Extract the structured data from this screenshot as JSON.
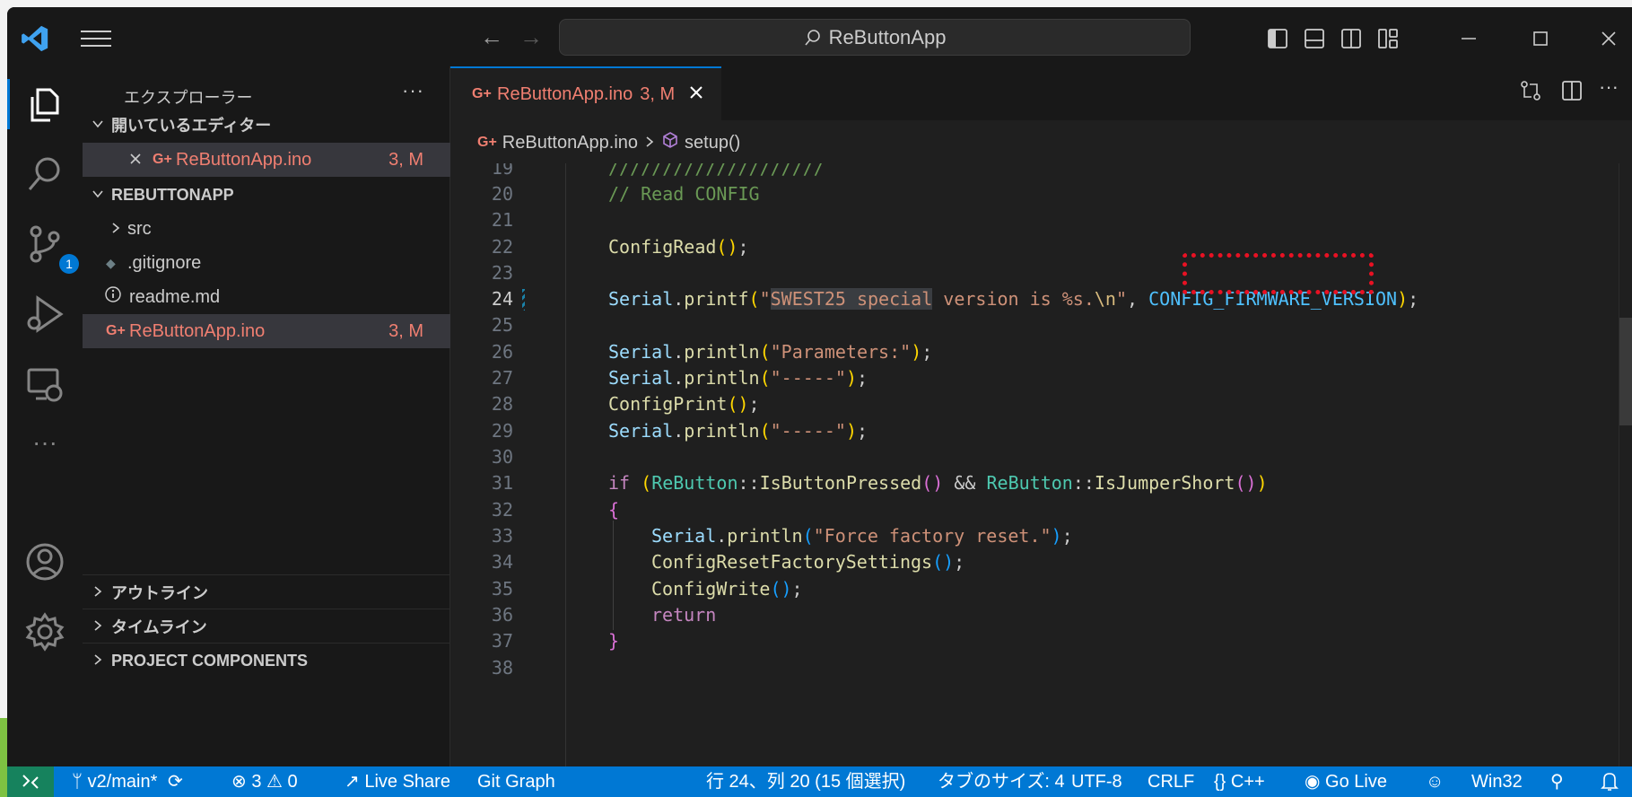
{
  "titlebar": {
    "search_text": "ReButtonApp",
    "back_glyph": "←",
    "forward_glyph": "→",
    "icons": [
      "toggle-primary-sidebar-icon",
      "toggle-panel-icon",
      "toggle-secondary-sidebar-icon",
      "customize-layout-icon"
    ],
    "window_controls": [
      "minimize-icon",
      "maximize-icon",
      "close-icon"
    ]
  },
  "activity_bar": {
    "items": [
      "explorer-icon",
      "search-icon",
      "source-control-icon",
      "run-debug-icon",
      "remote-explorer-icon",
      "more-icon"
    ],
    "source_control_badge": "1",
    "bottom": [
      "accounts-icon",
      "manage-gear-icon"
    ]
  },
  "sidebar": {
    "title": "エクスプローラー",
    "more": "···",
    "open_editors_label": "開いているエディター",
    "open_editor_file": "ReButtonApp.ino",
    "open_editor_deco": "3, M",
    "project_label": "REBUTTONAPP",
    "files": [
      {
        "name": "src",
        "type": "folder",
        "deco": ""
      },
      {
        "name": ".gitignore",
        "type": "gitignore",
        "deco": ""
      },
      {
        "name": "readme.md",
        "type": "info",
        "deco": ""
      },
      {
        "name": "ReButtonApp.ino",
        "type": "arduino",
        "deco": "3, M"
      }
    ],
    "outline_label": "アウトライン",
    "timeline_label": "タイムライン",
    "components_label": "PROJECT COMPONENTS"
  },
  "editor": {
    "tab_name": "ReButtonApp.ino",
    "tab_deco": "3, M",
    "breadcrumb_file": "ReButtonApp.ino",
    "breadcrumb_symbol": "setup()",
    "line_numbers": [
      "19",
      "20",
      "21",
      "22",
      "23",
      "24",
      "25",
      "26",
      "27",
      "28",
      "29",
      "30",
      "31",
      "32",
      "33",
      "34",
      "35",
      "36",
      "37",
      "38"
    ],
    "current_line": "24",
    "code": {
      "l19": "////////////////////",
      "l20": "// Read CONFIG",
      "l22_fn": "ConfigRead",
      "l24_obj": "Serial",
      "l24_fn": "printf",
      "l24_str_sel": "SWEST25 special",
      "l24_str_rest": " version is %s.",
      "l24_esc": "\\n",
      "l24_macro": "CONFIG_FIRMWARE_VERSION",
      "l26_str": "\"Parameters:\"",
      "l27_str": "\"-----\"",
      "l28_fn": "ConfigPrint",
      "l29_str": "\"-----\"",
      "l31_kw": "if",
      "l31_type": "ReButton",
      "l31_fn1": "IsButtonPressed",
      "l31_fn2": "IsJumperShort",
      "l33_str": "\"Force factory reset.\"",
      "l34_fn": "ConfigResetFactorySettings",
      "l35_fn": "ConfigWrite",
      "l36_kw": "return"
    }
  },
  "statusbar": {
    "branch": "v2/main*",
    "errors": "3",
    "warnings": "0",
    "live_share": "Live Share",
    "git_graph": "Git Graph",
    "cursor": "行 24、列 20 (15 個選択)",
    "tab_size": "タブのサイズ: 4",
    "encoding": "UTF-8",
    "eol": "CRLF",
    "language": "C++",
    "go_live": "Go Live",
    "platform": "Win32"
  },
  "colors": {
    "accent": "#0078d4",
    "modified": "#f07f71",
    "highlight_box": "#e81123"
  }
}
